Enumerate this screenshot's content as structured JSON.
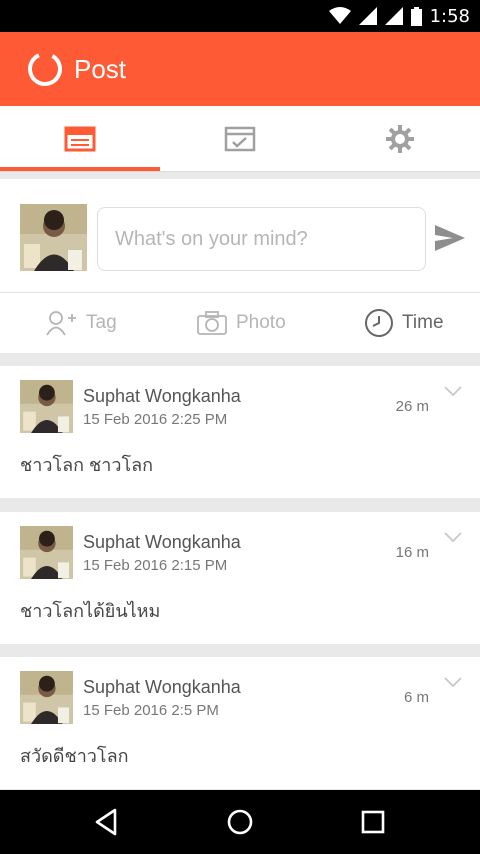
{
  "status_bar": {
    "time": "1:58",
    "icons": [
      "wifi-icon",
      "cell-signal-icon",
      "cell-signal-icon",
      "battery-icon"
    ]
  },
  "app_bar": {
    "title": "Post",
    "logo_icon": "circle-logo-icon",
    "color": "#ff5a36"
  },
  "tabs": [
    {
      "icon": "feed-icon",
      "active": true
    },
    {
      "icon": "checklist-icon",
      "active": false
    },
    {
      "icon": "gear-icon",
      "active": false
    }
  ],
  "composer": {
    "placeholder": "What's on your mind?",
    "send_icon": "send-icon",
    "actions": {
      "tag": "Tag",
      "photo": "Photo",
      "time": "Time"
    }
  },
  "posts": [
    {
      "author": "Suphat Wongkanha",
      "date": "15 Feb 2016  2:25 PM",
      "ago": "26 m",
      "text": "ชาวโลก ชาวโลก"
    },
    {
      "author": "Suphat Wongkanha",
      "date": "15 Feb 2016  2:15 PM",
      "ago": "16 m",
      "text": "ชาวโลกได้ยินไหม"
    },
    {
      "author": "Suphat Wongkanha",
      "date": "15 Feb 2016  2:5 PM",
      "ago": "6 m",
      "text": "สวัดดีชาวโลก"
    }
  ],
  "nav_bar": {
    "icons": [
      "back-icon",
      "home-icon",
      "recents-icon"
    ]
  }
}
